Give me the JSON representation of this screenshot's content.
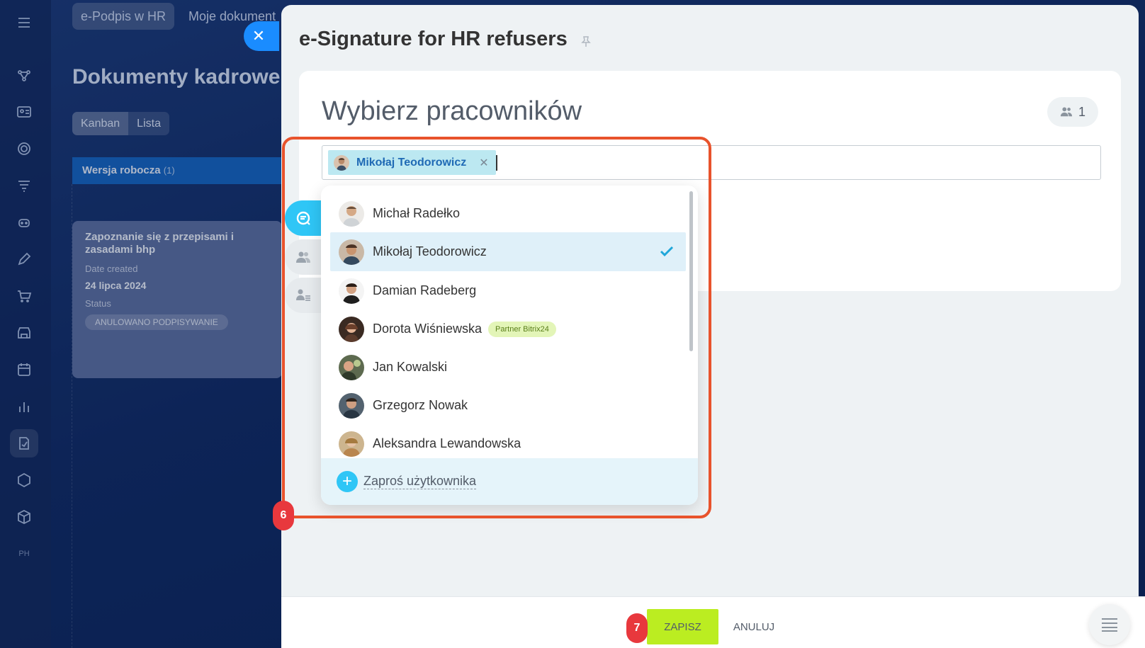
{
  "background_app": {
    "top_tabs": [
      "e-Podpis w HR",
      "Moje dokument"
    ],
    "page_title": "Dokumenty kadrowe",
    "view_switch": [
      "Kanban",
      "Lista"
    ],
    "column": {
      "title": "Wersja robocza",
      "count": "(1)"
    },
    "card": {
      "title": "Zapoznanie się z przepisami i zasadami bhp",
      "date_label": "Date created",
      "date_value": "24 lipca 2024",
      "status_label": "Status",
      "status_value": "ANULOWANO PODPISYWANIE"
    },
    "rail_icons": [
      "menu-icon",
      "flow-icon",
      "contacts-icon",
      "target-icon",
      "funnel-icon",
      "robot-icon",
      "pen-icon",
      "cart-icon",
      "store-icon",
      "calendar-icon",
      "chart-icon",
      "sign-doc-icon",
      "hexagon-icon",
      "box-icon",
      "ph-icon"
    ]
  },
  "panel": {
    "title": "e-Signature for HR refusers",
    "section_heading": "Wybierz pracowników",
    "selected_count": "1",
    "selected_tag": "Mikołaj Teodorowicz"
  },
  "dropdown": {
    "items": [
      {
        "name": "Michał Radełko",
        "selected": false,
        "badge": ""
      },
      {
        "name": "Mikołaj Teodorowicz",
        "selected": true,
        "badge": ""
      },
      {
        "name": "Damian Radeberg",
        "selected": false,
        "badge": ""
      },
      {
        "name": "Dorota Wiśniewska",
        "selected": false,
        "badge": "Partner Bitrix24"
      },
      {
        "name": "Jan Kowalski",
        "selected": false,
        "badge": ""
      },
      {
        "name": "Grzegorz Nowak",
        "selected": false,
        "badge": ""
      },
      {
        "name": "Aleksandra Lewandowska",
        "selected": false,
        "badge": ""
      }
    ],
    "invite_label": "Zaproś użytkownika"
  },
  "footer": {
    "save_label": "ZAPISZ",
    "cancel_label": "ANULUJ"
  },
  "annotations": {
    "step_6": "6",
    "step_7": "7"
  },
  "colors": {
    "accent": "#2fc6f6",
    "save_button": "#bbed21",
    "highlight": "#e8532c",
    "step_badge": "#e8383d",
    "close_button": "#1a8cff"
  }
}
